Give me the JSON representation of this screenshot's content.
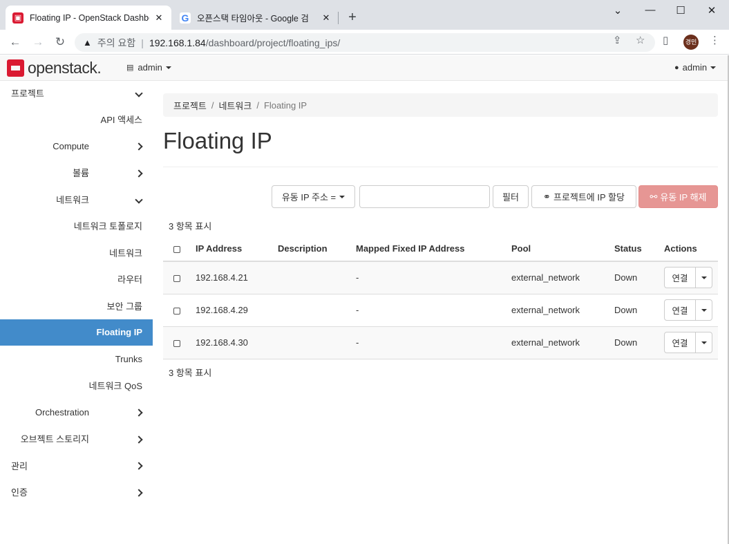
{
  "browser": {
    "tabs": [
      {
        "title": "Floating IP - OpenStack Dashbo",
        "active": true
      },
      {
        "title": "오픈스택 타임아웃 - Google 검",
        "active": false
      }
    ],
    "close_glyph": "✕",
    "new_tab_glyph": "+",
    "address": {
      "warning_label": "주의 요함",
      "host": "192.168.1.84",
      "path": "/dashboard/project/floating_ips/"
    },
    "profile_initials": "경민"
  },
  "navbar": {
    "brand": "openstack.",
    "project_label": "admin",
    "user_label": "admin"
  },
  "sidebar": {
    "items": [
      {
        "label": "프로젝트",
        "level": 0,
        "chevron": "down"
      },
      {
        "label": "API 액세스",
        "level": 2,
        "chevron": ""
      },
      {
        "label": "Compute",
        "level": 1,
        "chevron": "right"
      },
      {
        "label": "볼륨",
        "level": 1,
        "chevron": "right"
      },
      {
        "label": "네트워크",
        "level": 1,
        "chevron": "down"
      },
      {
        "label": "네트워크 토폴로지",
        "level": 2,
        "chevron": ""
      },
      {
        "label": "네트워크",
        "level": 2,
        "chevron": ""
      },
      {
        "label": "라우터",
        "level": 2,
        "chevron": ""
      },
      {
        "label": "보안 그룹",
        "level": 2,
        "chevron": ""
      },
      {
        "label": "Floating IP",
        "level": 2,
        "chevron": "",
        "active": true
      },
      {
        "label": "Trunks",
        "level": 2,
        "chevron": ""
      },
      {
        "label": "네트워크 QoS",
        "level": 2,
        "chevron": ""
      },
      {
        "label": "Orchestration",
        "level": 1,
        "chevron": "right"
      },
      {
        "label": "오브젝트 스토리지",
        "level": 1,
        "chevron": "right"
      },
      {
        "label": "관리",
        "level": 0,
        "chevron": "right"
      },
      {
        "label": "인증",
        "level": 0,
        "chevron": "right"
      }
    ]
  },
  "breadcrumb": {
    "items": [
      "프로젝트",
      "네트워크"
    ],
    "separator": "/",
    "current": "Floating IP"
  },
  "page_title": "Floating IP",
  "filter": {
    "select_label": "유동 IP 주소 =",
    "input_value": "",
    "filter_button": "필터",
    "allocate_button": "프로젝트에 IP 할당",
    "release_button": "유동 IP 해제"
  },
  "count_text": "3 항목 표시",
  "table": {
    "columns": [
      "IP Address",
      "Description",
      "Mapped Fixed IP Address",
      "Pool",
      "Status",
      "Actions"
    ],
    "rows": [
      {
        "ip": "192.168.4.21",
        "description": "",
        "mapped": "-",
        "pool": "external_network",
        "status": "Down",
        "action": "연결"
      },
      {
        "ip": "192.168.4.29",
        "description": "",
        "mapped": "-",
        "pool": "external_network",
        "status": "Down",
        "action": "연결"
      },
      {
        "ip": "192.168.4.30",
        "description": "",
        "mapped": "-",
        "pool": "external_network",
        "status": "Down",
        "action": "연결"
      }
    ]
  },
  "colors": {
    "accent": "#428bca",
    "brand": "#da1a32",
    "danger": "#e69694"
  }
}
